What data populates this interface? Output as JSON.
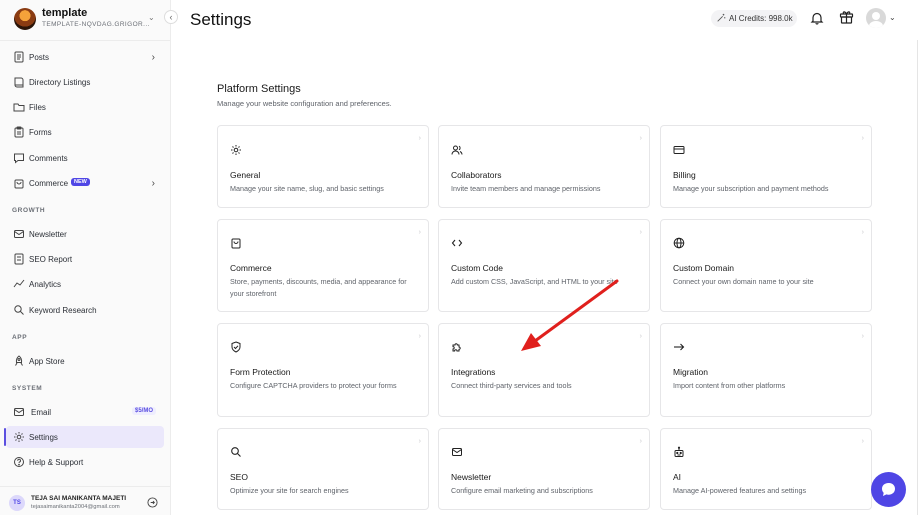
{
  "workspace": {
    "name": "template",
    "subdomain": "TEMPLATE-NQVDAG.GRIGOR..."
  },
  "nav": {
    "posts": "Posts",
    "directory": "Directory Listings",
    "files": "Files",
    "forms": "Forms",
    "comments": "Comments",
    "commerce": "Commerce",
    "commerce_badge": "NEW",
    "growth_label": "GROWTH",
    "newsletter": "Newsletter",
    "seo_report": "SEO Report",
    "analytics": "Analytics",
    "keyword": "Keyword Research",
    "app_label": "APP",
    "app_store": "App Store",
    "system_label": "SYSTEM",
    "email": "Email",
    "email_badge": "$5/MO",
    "settings": "Settings",
    "help": "Help & Support"
  },
  "user": {
    "name": "TEJA SAI MANIKANTA MAJETI",
    "email": "tejasaimanikanta2004@gmail.com",
    "initials": "TS"
  },
  "header": {
    "title": "Settings",
    "ai_credits": "AI Credits: 998.0k"
  },
  "platform": {
    "title": "Platform Settings",
    "description": "Manage your website configuration and preferences."
  },
  "cards": [
    {
      "title": "General",
      "desc": "Manage your site name, slug, and basic settings",
      "icon": "gear-icon"
    },
    {
      "title": "Collaborators",
      "desc": "Invite team members and manage permissions",
      "icon": "users-icon"
    },
    {
      "title": "Billing",
      "desc": "Manage your subscription and payment methods",
      "icon": "credit-card-icon"
    },
    {
      "title": "Commerce",
      "desc": "Store, payments, discounts, media, and appearance for your storefront",
      "icon": "bag-icon"
    },
    {
      "title": "Custom Code",
      "desc": "Add custom CSS, JavaScript, and HTML to your site",
      "icon": "code-icon"
    },
    {
      "title": "Custom Domain",
      "desc": "Connect your own domain name to your site",
      "icon": "globe-icon"
    },
    {
      "title": "Form Protection",
      "desc": "Configure CAPTCHA providers to protect your forms",
      "icon": "shield-icon"
    },
    {
      "title": "Integrations",
      "desc": "Connect third-party services and tools",
      "icon": "puzzle-icon"
    },
    {
      "title": "Migration",
      "desc": "Import content from other platforms",
      "icon": "arrow-right-icon"
    },
    {
      "title": "SEO",
      "desc": "Optimize your site for search engines",
      "icon": "search-icon"
    },
    {
      "title": "Newsletter",
      "desc": "Configure email marketing and subscriptions",
      "icon": "mail-icon"
    },
    {
      "title": "AI",
      "desc": "Manage AI-powered features and settings",
      "icon": "robot-icon"
    }
  ],
  "colors": {
    "accent": "#4f46e5",
    "annotation_arrow": "#e0201d"
  }
}
